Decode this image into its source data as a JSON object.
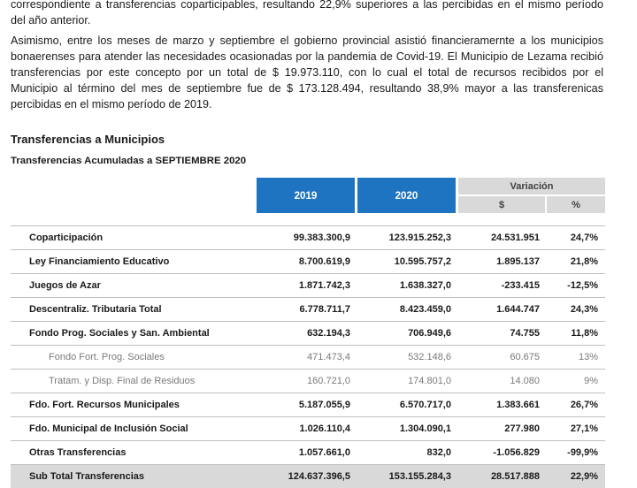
{
  "paragraphs": {
    "p1": [
      "correspondiente a transferencias coparticipables, resultando 22,9% superiores a las percibidas en el mismo período",
      "del año anterior."
    ],
    "p2": [
      "Asimismo, entre los meses de marzo y septiembre el gobierno provincial asistió financieramernte a los municipios",
      "bonaerenses para atender las necesidades ocasionadas por la pandemia de Covid-19. El Municipio de Lezama recibió",
      "transferencias por este concepto por un total de $ 19.973.110, con lo cual el total de recursos recibidos por el",
      "Municipio al término del mes de septiembre fue de $ 173.128.494, resultando 38,9% mayor a las transferenicas",
      "percibidas en el mismo período de 2019."
    ]
  },
  "section_title": "Transferencias a Municipios",
  "table_title": "Transferencias Acumuladas a SEPTIEMBRE 2020",
  "table": {
    "header": {
      "year1": "2019",
      "year2": "2020",
      "variation": "Variación",
      "unit_abs": "$",
      "unit_pct": "%"
    },
    "rows": [
      {
        "label": "Coparticipación",
        "v2019": "99.383.300,9",
        "v2020": "123.915.252,3",
        "var_abs": "24.531.951",
        "var_pct": "24,7%",
        "sub": false
      },
      {
        "label": "Ley Financiamiento Educativo",
        "v2019": "8.700.619,9",
        "v2020": "10.595.757,2",
        "var_abs": "1.895.137",
        "var_pct": "21,8%",
        "sub": false
      },
      {
        "label": "Juegos de Azar",
        "v2019": "1.871.742,3",
        "v2020": "1.638.327,0",
        "var_abs": "-233.415",
        "var_pct": "-12,5%",
        "sub": false
      },
      {
        "label": "Descentraliz. Tributaria Total",
        "v2019": "6.778.711,7",
        "v2020": "8.423.459,0",
        "var_abs": "1.644.747",
        "var_pct": "24,3%",
        "sub": false
      },
      {
        "label": "Fondo Prog. Sociales y San. Ambiental",
        "v2019": "632.194,3",
        "v2020": "706.949,6",
        "var_abs": "74.755",
        "var_pct": "11,8%",
        "sub": false
      },
      {
        "label": "Fondo Fort. Prog. Sociales",
        "v2019": "471.473,4",
        "v2020": "532.148,6",
        "var_abs": "60.675",
        "var_pct": "13%",
        "sub": true
      },
      {
        "label": "Tratam. y Disp. Final de Residuos",
        "v2019": "160.721,0",
        "v2020": "174.801,0",
        "var_abs": "14.080",
        "var_pct": "9%",
        "sub": true
      },
      {
        "label": "Fdo. Fort. Recursos Municipales",
        "v2019": "5.187.055,9",
        "v2020": "6.570.717,0",
        "var_abs": "1.383.661",
        "var_pct": "26,7%",
        "sub": false
      },
      {
        "label": "Fdo. Municipal de Inclusión Social",
        "v2019": "1.026.110,4",
        "v2020": "1.304.090,1",
        "var_abs": "277.980",
        "var_pct": "27,1%",
        "sub": false
      },
      {
        "label": "Otras Transferencias",
        "v2019": "1.057.661,0",
        "v2020": "832,0",
        "var_abs": "-1.056.829",
        "var_pct": "-99,9%",
        "sub": false
      }
    ],
    "total": {
      "label": "Sub Total Transferencias",
      "v2019": "124.637.396,5",
      "v2020": "153.155.284,3",
      "var_abs": "28.517.888",
      "var_pct": "22,9%"
    }
  }
}
